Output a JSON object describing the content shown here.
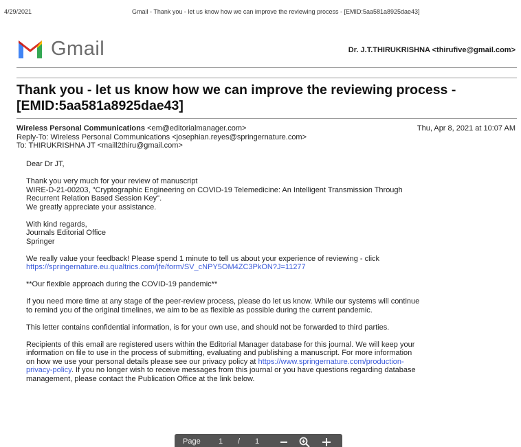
{
  "print_header": {
    "date": "4/29/2021",
    "title": "Gmail - Thank you - let us know how we can improve the reviewing process - [EMID:5aa581a8925dae43]"
  },
  "logo": {
    "wordmark": "Gmail"
  },
  "account": {
    "name": "Dr. J.T.THIRUKRISHNA <thirufive@gmail.com>"
  },
  "email": {
    "subject_line1": "Thank you - let us know how we can improve the reviewing process -",
    "subject_line2": "[EMID:5aa581a8925dae43]",
    "from_name": "Wireless Personal Communications",
    "from_email": " <em@editorialmanager.com>",
    "date": "Thu, Apr 8, 2021 at 10:07 AM",
    "reply_to": "Reply-To: Wireless Personal Communications <josephian.reyes@springernature.com>",
    "to": "To: THIRUKRISHNA JT <maill2thiru@gmail.com>",
    "body": {
      "greeting": "Dear Dr JT,",
      "thanks_line1": "Thank you very much for your review of manuscript",
      "thanks_line2": "WIRE-D-21-00203, \"Cryptographic Engineering on COVID-19 Telemedicine: An Intelligent Transmission Through",
      "thanks_line3": "Recurrent Relation Based Session Key\".",
      "thanks_line4": "We greatly appreciate your assistance.",
      "regards_line1": "With kind regards,",
      "regards_line2": "Journals Editorial Office",
      "regards_line3": "Springer",
      "feedback_line1": "We really value your feedback! Please spend 1 minute to tell us about your experience of reviewing - click",
      "feedback_link": "https://springernature.eu.qualtrics.com/jfe/form/SV_cNPY5OM4ZC3PkON?J=11277",
      "covid_heading": "**Our flexible approach during the COVID-19 pandemic**",
      "time_line1": "If you need more time at any stage of the peer-review process, please do let us know. While our systems will continue",
      "time_line2": "to remind you of the original timelines, we aim to be as flexible as possible during the current pandemic.",
      "confidential": "This letter contains confidential information, is for your own use, and should not be forwarded to third parties.",
      "recipients_line1": "Recipients of this email are registered users within the Editorial Manager database for this journal. We will keep your",
      "recipients_line2": "information on file to use in the process of submitting, evaluating and publishing a manuscript. For more information",
      "recipients_line3": "on how we use your personal details please see our privacy policy at ",
      "privacy_link_part1": "https://www.springernature.com/production-",
      "privacy_link_part2": "privacy-policy",
      "recipients_line4": ". If you no longer wish to receive messages from this journal or you have questions regarding database",
      "recipients_line5": "management, please contact the Publication Office at the link below."
    }
  },
  "pdf_toolbar": {
    "page_label": "Page",
    "current_page": "1",
    "separator": "/",
    "total_pages": "1"
  }
}
